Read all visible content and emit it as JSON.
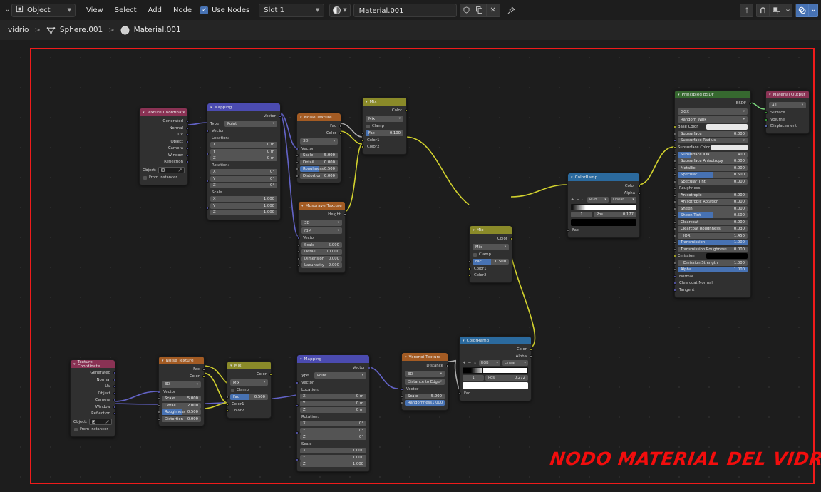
{
  "header": {
    "editor_type": "Object",
    "menus": [
      "View",
      "Select",
      "Add",
      "Node"
    ],
    "use_nodes_label": "Use Nodes",
    "slot_label": "Slot 1",
    "material_name": "Material.001",
    "icons": [
      "shield-icon",
      "duplicate-icon",
      "close-icon",
      "pin-icon",
      "snap-magnet-icon",
      "snap-grid-icon",
      "overlay-icon"
    ]
  },
  "breadcrumb": {
    "items": [
      {
        "label": "vidrio",
        "icon": ""
      },
      {
        "label": "Sphere.001",
        "icon": "mesh-data-icon"
      },
      {
        "label": "Material.001",
        "icon": "material-icon"
      }
    ],
    "separator": ">"
  },
  "watermark": {
    "text": "NODO MATERIAL DEL VIDRIO",
    "color": "#f20d0d"
  },
  "frame": {
    "color": "#ef1b1b"
  },
  "nodes": {
    "texcoord_top": {
      "title": "Texture Coordinate",
      "header_color": "#8a3254",
      "outputs": [
        "Generated",
        "Normal",
        "UV",
        "Object",
        "Camera",
        "Window",
        "Reflection"
      ],
      "object_label": "Object:",
      "from_instancer_label": "From Instancer"
    },
    "mapping_top": {
      "title": "Mapping",
      "header_color": "#4b4bb0",
      "output": "Vector",
      "type_label": "Type",
      "type_value": "Point",
      "vector_label": "Vector",
      "location_label": "Location:",
      "location": [
        {
          "axis": "X",
          "value": "0 m"
        },
        {
          "axis": "Y",
          "value": "0 m"
        },
        {
          "axis": "Z",
          "value": "0 m"
        }
      ],
      "rotation_label": "Rotation:",
      "rotation": [
        {
          "axis": "X",
          "value": "0°"
        },
        {
          "axis": "Y",
          "value": "0°"
        },
        {
          "axis": "Z",
          "value": "0°"
        }
      ],
      "scale_label": "Scale",
      "scale": [
        {
          "axis": "X",
          "value": "1.000"
        },
        {
          "axis": "Y",
          "value": "1.000"
        },
        {
          "axis": "Z",
          "value": "1.000"
        }
      ]
    },
    "noise_top": {
      "title": "Noise Texture",
      "header_color": "#a35b23",
      "outputs": [
        "Fac",
        "Color"
      ],
      "dimension": "3D",
      "vector_label": "Vector",
      "props": [
        {
          "label": "Scale",
          "value": "5.000",
          "fill": 0
        },
        {
          "label": "Detail",
          "value": "0.000",
          "fill": 0
        },
        {
          "label": "Roughness",
          "value": "0.500",
          "fill": 0.5
        },
        {
          "label": "Distortion",
          "value": "0.000",
          "fill": 0
        }
      ]
    },
    "musgrave": {
      "title": "Musgrave Texture",
      "header_color": "#a35b23",
      "output": "Height",
      "dimension": "3D",
      "mode": "fBM",
      "vector_label": "Vector",
      "props": [
        {
          "label": "Scale",
          "value": "5.000"
        },
        {
          "label": "Detail",
          "value": "10.000"
        },
        {
          "label": "Dimension",
          "value": "0.000"
        },
        {
          "label": "Lacunarity",
          "value": "2.000"
        }
      ]
    },
    "mix_top": {
      "title": "Mix",
      "header_color": "#8a8a29",
      "output": "Color",
      "blend_mode": "Mix",
      "clamp_label": "Clamp",
      "fac_label": "Fac",
      "fac_value": "0.100",
      "fac_fill": 0.1,
      "inputs": [
        "Color1",
        "Color2"
      ]
    },
    "mix_mid": {
      "title": "Mix",
      "header_color": "#8a8a29",
      "output": "Color",
      "blend_mode": "Mix",
      "clamp_label": "Clamp",
      "fac_label": "Fac",
      "fac_value": "0.500",
      "fac_fill": 0.5,
      "inputs": [
        "Color1",
        "Color2"
      ]
    },
    "colorramp_top": {
      "title": "ColorRamp",
      "header_color": "#2b6a9e",
      "outputs": [
        "Color",
        "Alpha"
      ],
      "interpolation": "Linear",
      "color_mode": "RGB",
      "index": "1",
      "pos_label": "Pos",
      "pos_value": "0.177",
      "swatch_color": "#000000",
      "ramp_gradient": "linear-gradient(90deg,#000 0%,#fff 22%,#fff 100%)",
      "input": "Fac"
    },
    "colorramp_bot": {
      "title": "ColorRamp",
      "header_color": "#2b6a9e",
      "outputs": [
        "Color",
        "Alpha"
      ],
      "interpolation": "Linear",
      "color_mode": "RGB",
      "index": "1",
      "pos_label": "Pos",
      "pos_value": "0.272",
      "swatch_color": "#ffffff",
      "ramp_gradient": "linear-gradient(90deg,#000 0%,#000 12%,#fff 32%,#fff 100%)",
      "input": "Fac"
    },
    "principled": {
      "title": "Principled BSDF",
      "header_color": "#36682f",
      "output": "BSDF",
      "distribution": "GGX",
      "subsurface_method": "Random Walk",
      "props": [
        {
          "label": "Base Color",
          "type": "swatch",
          "color": "#e8e8e8",
          "sock": "s-yellow"
        },
        {
          "label": "Subsurface",
          "type": "slider",
          "value": "0.000",
          "fill": 0,
          "sock": "s-dgrey"
        },
        {
          "label": "Subsurface Radius",
          "type": "dropdown",
          "sock": "s-purple"
        },
        {
          "label": "Subsurface Color",
          "type": "swatch",
          "color": "#e8e8e8",
          "sock": "s-yellow"
        },
        {
          "label": "Subsurface IOR",
          "type": "slider",
          "value": "1.400",
          "fill": 0.18,
          "sock": "s-dgrey"
        },
        {
          "label": "Subsurface Anisotropy",
          "type": "slider",
          "value": "0.000",
          "fill": 0,
          "sock": "s-dgrey"
        },
        {
          "label": "Metallic",
          "type": "slider",
          "value": "0.000",
          "fill": 0,
          "sock": "s-dgrey"
        },
        {
          "label": "Specular",
          "type": "slider",
          "value": "0.500",
          "fill": 0.5,
          "sock": "s-dgrey"
        },
        {
          "label": "Specular Tint",
          "type": "slider",
          "value": "0.000",
          "fill": 0,
          "sock": "s-dgrey"
        },
        {
          "label": "Roughness",
          "type": "text",
          "sock": "s-dgrey"
        },
        {
          "label": "Anisotropic",
          "type": "slider",
          "value": "0.000",
          "fill": 0,
          "sock": "s-dgrey"
        },
        {
          "label": "Anisotropic Rotation",
          "type": "slider",
          "value": "0.000",
          "fill": 0,
          "sock": "s-dgrey"
        },
        {
          "label": "Sheen",
          "type": "slider",
          "value": "0.000",
          "fill": 0,
          "sock": "s-dgrey"
        },
        {
          "label": "Sheen Tint",
          "type": "slider",
          "value": "0.500",
          "fill": 0.5,
          "sock": "s-dgrey"
        },
        {
          "label": "Clearcoat",
          "type": "slider",
          "value": "0.000",
          "fill": 0,
          "sock": "s-dgrey"
        },
        {
          "label": "Clearcoat Roughness",
          "type": "slider",
          "value": "0.030",
          "fill": 0.03,
          "sock": "s-dgrey"
        },
        {
          "label": "IOR",
          "type": "slider",
          "value": "1.450",
          "fill": 0,
          "sock": "s-dgrey"
        },
        {
          "label": "Transmission",
          "type": "slider",
          "value": "1.000",
          "fill": 1,
          "sock": "s-dgrey"
        },
        {
          "label": "Transmission Roughness",
          "type": "slider",
          "value": "0.000",
          "fill": 0,
          "sock": "s-dgrey"
        },
        {
          "label": "Emission",
          "type": "swatch",
          "color": "#000000",
          "sock": "s-yellow"
        },
        {
          "label": "Emission Strength",
          "type": "slider",
          "value": "1.000",
          "fill": 0,
          "sock": "s-dgrey"
        },
        {
          "label": "Alpha",
          "type": "slider",
          "value": "1.000",
          "fill": 1,
          "sock": "s-dgrey"
        },
        {
          "label": "Normal",
          "type": "text",
          "sock": "s-purple"
        },
        {
          "label": "Clearcoat Normal",
          "type": "text",
          "sock": "s-purple"
        },
        {
          "label": "Tangent",
          "type": "text",
          "sock": "s-purple"
        }
      ]
    },
    "material_output": {
      "title": "Material Output",
      "header_color": "#8a3254",
      "target": "All",
      "inputs": [
        "Surface",
        "Volume",
        "Displacement"
      ]
    },
    "texcoord_bot": {
      "title": "Texture Coordinate",
      "header_color": "#8a3254",
      "outputs": [
        "Generated",
        "Normal",
        "UV",
        "Object",
        "Camera",
        "Window",
        "Reflection"
      ],
      "object_label": "Object:",
      "from_instancer_label": "From Instancer"
    },
    "noise_bot": {
      "title": "Noise Texture",
      "header_color": "#a35b23",
      "outputs": [
        "Fac",
        "Color"
      ],
      "dimension": "3D",
      "vector_label": "Vector",
      "props": [
        {
          "label": "Scale",
          "value": "5.000",
          "fill": 0
        },
        {
          "label": "Detail",
          "value": "2.000",
          "fill": 0
        },
        {
          "label": "Roughness",
          "value": "0.500",
          "fill": 0.5
        },
        {
          "label": "Distortion",
          "value": "0.000",
          "fill": 0
        }
      ]
    },
    "mix_bot": {
      "title": "Mix",
      "header_color": "#8a8a29",
      "output": "Color",
      "blend_mode": "Mix",
      "clamp_label": "Clamp",
      "fac_label": "Fac",
      "fac_value": "0.500",
      "fac_fill": 0.5,
      "inputs": [
        "Color1",
        "Color2"
      ]
    },
    "mapping_bot": {
      "title": "Mapping",
      "header_color": "#4b4bb0",
      "output": "Vector",
      "type_label": "Type",
      "type_value": "Point",
      "vector_label": "Vector",
      "location_label": "Location:",
      "location": [
        {
          "axis": "X",
          "value": "0 m"
        },
        {
          "axis": "Y",
          "value": "0 m"
        },
        {
          "axis": "Z",
          "value": "0 m"
        }
      ],
      "rotation_label": "Rotation:",
      "rotation": [
        {
          "axis": "X",
          "value": "0°"
        },
        {
          "axis": "Y",
          "value": "0°"
        },
        {
          "axis": "Z",
          "value": "0°"
        }
      ],
      "scale_label": "Scale",
      "scale": [
        {
          "axis": "X",
          "value": "1.000"
        },
        {
          "axis": "Y",
          "value": "1.000"
        },
        {
          "axis": "Z",
          "value": "1.000"
        }
      ]
    },
    "voronoi": {
      "title": "Voronoi Texture",
      "header_color": "#a35b23",
      "output": "Distance",
      "dimension": "3D",
      "feature": "Distance to Edge",
      "vector_label": "Vector",
      "props": [
        {
          "label": "Scale",
          "value": "5.000",
          "fill": 0
        },
        {
          "label": "Randomness",
          "value": "1.000",
          "fill": 1
        }
      ]
    }
  }
}
